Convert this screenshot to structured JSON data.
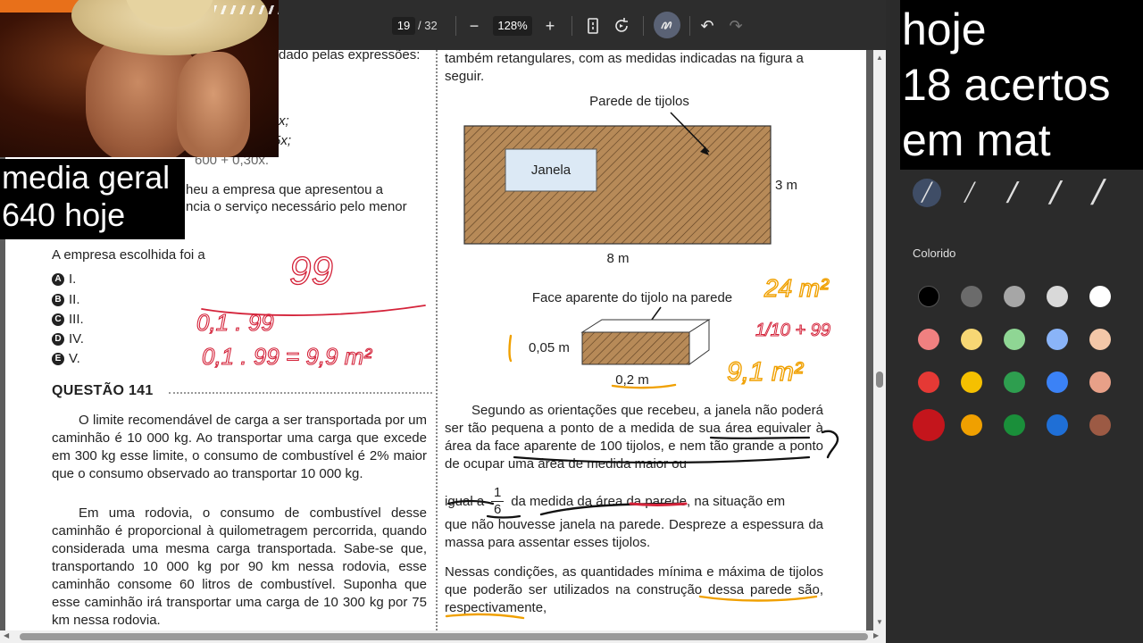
{
  "toolbar": {
    "page_current": "19",
    "page_total": "/ 32",
    "zoom_out": "−",
    "zoom_level": "128%",
    "zoom_in": "+",
    "undo": "↶",
    "redo": "↷"
  },
  "left_column": {
    "partial_top": "dado pelas expressões:",
    "formula_1": "x;",
    "formula_2": "5x;",
    "formula_3": "600 + 0,30x.",
    "partial_q_1": "heu a empresa que apresentou a",
    "partial_q_2": "ncia o serviço necessário pelo menor",
    "prompt": "A empresa escolhida foi a",
    "options": [
      {
        "letter": "A",
        "text": "I."
      },
      {
        "letter": "B",
        "text": "II."
      },
      {
        "letter": "C",
        "text": "III."
      },
      {
        "letter": "D",
        "text": "IV."
      },
      {
        "letter": "E",
        "text": "V."
      }
    ],
    "question_title": "QUESTÃO 141",
    "paragraph_1": "O limite recomendável de carga a ser transportada por um caminhão é 10 000 kg. Ao transportar uma carga que excede em 300 kg esse limite, o consumo de combustível é 2% maior que o consumo observado ao transportar 10 000 kg.",
    "paragraph_2": "Em uma rodovia, o consumo de combustível desse caminhão é proporcional à quilometragem percorrida, quando considerada uma mesma carga transportada. Sabe-se que, transportando 10 000 kg por 90 km nessa rodovia, esse caminhão consome 60 litros de combustível. Suponha que esse caminhão irá transportar uma carga de 10 300 kg por 75 km nessa rodovia."
  },
  "right_column": {
    "intro": "também retangulares, com as medidas indicadas na figura a seguir.",
    "fig_wall_label": "Parede de tijolos",
    "fig_window_label": "Janela",
    "fig_height": "3 m",
    "fig_width": "8 m",
    "fig_brick_label": "Face aparente do tijolo na parede",
    "fig_brick_height": "0,05 m",
    "fig_brick_width": "0,2 m",
    "para_a": "Segundo as orientações que recebeu, a janela não poderá ser tão pequena a ponto de a medida de sua área equivaler à área da face aparente de 100 tijolos, e nem tão grande a ponto de ocupar uma área de medida maior ou",
    "frac_lead": "igual a",
    "frac_num": "1",
    "frac_den": "6",
    "frac_tail": "da medida da área da parede, na situação em",
    "para_b": "que não houvesse janela na parede. Despreze a espessura da massa para assentar esses tijolos.",
    "para_c": "Nessas condições, as quantidades mínima e máxima de tijolos que poderão ser utilizados na construção dessa parede são, respectivamente,"
  },
  "handwriting": {
    "left_1": "99",
    "left_2": "0,1 . 99",
    "left_3": "0,1 . 99 = 9,9 m²",
    "right_1": "24 m²",
    "right_2": "1/10 + 99",
    "right_3": "9,1 m²"
  },
  "panel": {
    "colorido_label": "Colorido",
    "swatches": [
      "#000000",
      "#6b6b6b",
      "#a6a6a6",
      "#d9d9d9",
      "#ffffff",
      "#f08080",
      "#f7d774",
      "#8fd694",
      "#8ab4f8",
      "#f3c7a8",
      "#e53935",
      "#f5c000",
      "#2e9e4f",
      "#3b82f6",
      "#e8a088",
      "#c4151c",
      "#f0a000",
      "#1a8f3a",
      "#1f6fd6",
      "#9c5a44"
    ]
  },
  "overlays": {
    "left_line_1": "media geral",
    "left_line_2": "640 hoje",
    "right_line_1": "hoje",
    "right_line_2": "18 acertos",
    "right_line_3": "em mat"
  }
}
